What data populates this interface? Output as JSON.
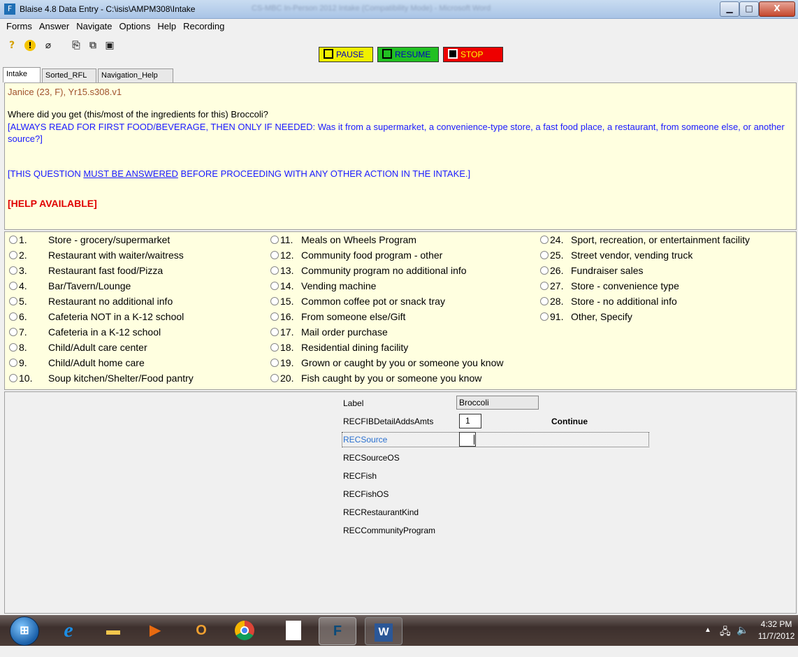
{
  "window": {
    "title": "Blaise 4.8 Data Entry - C:\\isis\\AMPM308\\Intake",
    "background_title": "CS-MBC In-Person 2012 Intake (Compatibility Mode) - Microsoft Word",
    "min_glyph": "▁",
    "max_glyph": "□",
    "close_glyph": "X"
  },
  "menu": [
    "Forms",
    "Answer",
    "Navigate",
    "Options",
    "Help",
    "Recording"
  ],
  "toolbar": {
    "icons": [
      "question-mark-icon",
      "exclamation-icon",
      "paperclip-icon",
      "find-icon",
      "copy-icon",
      "save-icon"
    ],
    "help_glyph": "?",
    "excl_glyph": "!",
    "clip_glyph": "⌀",
    "find_glyph": "⎘",
    "copy_glyph": "⧉",
    "save_glyph": "▣",
    "pause_label": "PAUSE",
    "resume_label": "RESUME",
    "stop_label": "STOP"
  },
  "tabs": [
    "Intake",
    "Sorted_RFL",
    "Navigation_Help"
  ],
  "question": {
    "person": "Janice (23, F),    Yr15.s308.v1",
    "text": "Where did you get (this/most of the ingredients for this) Broccoli?",
    "instruction": "[ALWAYS READ FOR FIRST FOOD/BEVERAGE, THEN ONLY IF NEEDED: Was it from a supermarket, a convenience-type store, a fast food place, a restaurant, from someone else, or another source?]",
    "must_pre": "[THIS QUESTION ",
    "must_underlined": "MUST BE ANSWERED",
    "must_post": " BEFORE PROCEEDING WITH ANY OTHER ACTION IN THE INTAKE.]",
    "help": "[HELP AVAILABLE]"
  },
  "answers": {
    "col1": [
      {
        "num": "1.",
        "label": "Store - grocery/supermarket"
      },
      {
        "num": "2.",
        "label": "Restaurant with waiter/waitress"
      },
      {
        "num": "3.",
        "label": "Restaurant fast food/Pizza"
      },
      {
        "num": "4.",
        "label": "Bar/Tavern/Lounge"
      },
      {
        "num": "5.",
        "label": "Restaurant no additional info"
      },
      {
        "num": "6.",
        "label": "Cafeteria NOT in a K-12 school"
      },
      {
        "num": "7.",
        "label": "Cafeteria in a K-12 school"
      },
      {
        "num": "8.",
        "label": "Child/Adult care center"
      },
      {
        "num": "9.",
        "label": "Child/Adult home care"
      },
      {
        "num": "10.",
        "label": "Soup kitchen/Shelter/Food pantry"
      }
    ],
    "col2": [
      {
        "num": "11.",
        "label": "Meals on Wheels Program"
      },
      {
        "num": "12.",
        "label": "Community food program - other"
      },
      {
        "num": "13.",
        "label": "Community program no additional info"
      },
      {
        "num": "14.",
        "label": "Vending machine"
      },
      {
        "num": "15.",
        "label": "Common coffee pot or snack tray"
      },
      {
        "num": "16.",
        "label": "From someone else/Gift"
      },
      {
        "num": "17.",
        "label": "Mail order purchase"
      },
      {
        "num": "18.",
        "label": "Residential dining facility"
      },
      {
        "num": "19.",
        "label": "Grown or caught by you or someone you know"
      },
      {
        "num": "20.",
        "label": "Fish caught by you or someone you know"
      }
    ],
    "col3": [
      {
        "num": "24.",
        "label": "Sport, recreation, or entertainment facility"
      },
      {
        "num": "25.",
        "label": "Street vendor, vending truck"
      },
      {
        "num": "26.",
        "label": "Fundraiser sales"
      },
      {
        "num": "27.",
        "label": "Store - convenience type"
      },
      {
        "num": "28.",
        "label": "Store - no additional info"
      },
      {
        "num": "91.",
        "label": "Other, Specify"
      }
    ]
  },
  "fields": {
    "label": {
      "name": "Label",
      "value": "Broccoli"
    },
    "adds": {
      "name": "RECFIBDetailAddsAmts",
      "value": "1",
      "note": "Continue"
    },
    "source": {
      "name": "RECSource",
      "value": ""
    },
    "sourceos": {
      "name": "RECSourceOS"
    },
    "fish": {
      "name": "RECFish"
    },
    "fishos": {
      "name": "RECFishOS"
    },
    "restaurant": {
      "name": "RECRestaurantKind"
    },
    "community": {
      "name": "RECCommunityProgram"
    }
  },
  "taskbar": {
    "apps": [
      "start-button",
      "internet-explorer-icon",
      "file-explorer-icon",
      "media-player-icon",
      "outlook-icon",
      "chrome-icon",
      "blank-document-icon",
      "blaise-icon",
      "word-icon"
    ],
    "start_glyph": "⊞",
    "ie_glyph": "e",
    "folder_glyph": "▬",
    "media_glyph": "▶",
    "outlook_glyph": "O",
    "blaise_glyph": "F",
    "word_glyph": "W",
    "tray_arrow": "▲",
    "tray_net": "🖧",
    "tray_vol": "🔈",
    "time": "4:32 PM",
    "date": "11/7/2012"
  }
}
